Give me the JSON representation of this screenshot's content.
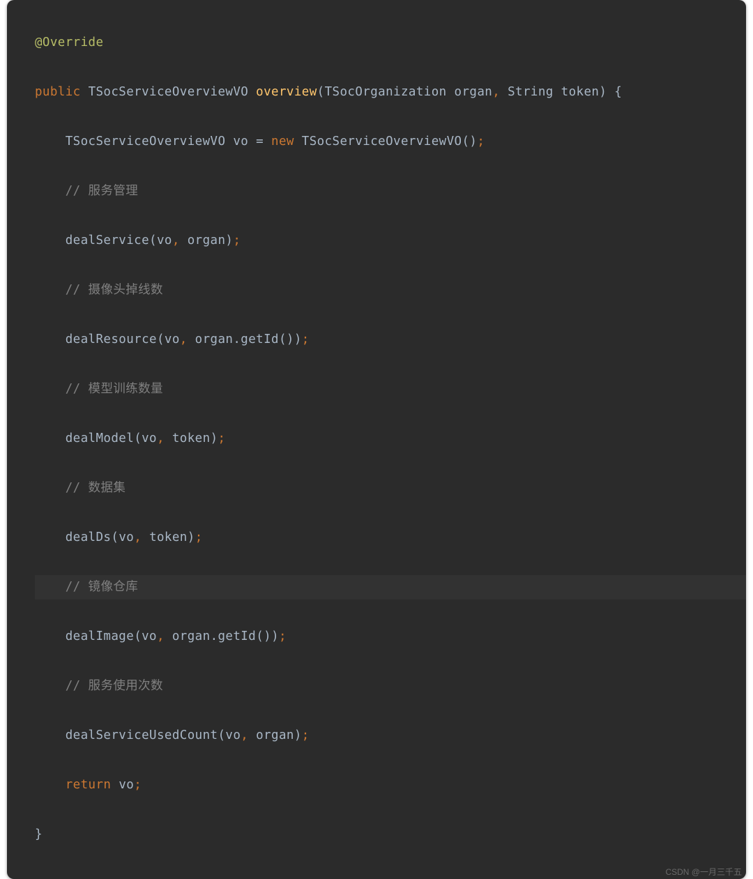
{
  "code": {
    "line1": {
      "anno": "@Override"
    },
    "line2": {
      "kw_public": "public",
      "ret_type": "TSocServiceOverviewVO",
      "method": "overview",
      "p1_type": "TSocOrganization",
      "p1_name": "organ",
      "p2_type": "String",
      "p2_name": "token",
      "open_brace": "{"
    },
    "line3": {
      "type": "TSocServiceOverviewVO",
      "var": "vo",
      "eq": "=",
      "kw_new": "new",
      "ctor": "TSocServiceOverviewVO",
      "parens": "()",
      "semi": ";"
    },
    "line4": {
      "comment": "// 服务管理"
    },
    "line5": {
      "call": "dealService",
      "args_open": "(",
      "a1": "vo",
      "c": ", ",
      "a2": "organ",
      "args_close": ")",
      "semi": ";"
    },
    "line6": {
      "comment": "// 摄像头掉线数"
    },
    "line7": {
      "call": "dealResource",
      "args_open": "(",
      "a1": "vo",
      "c": ", ",
      "a2": "organ",
      "dot": ".",
      "sub": "getId",
      "subp": "()",
      "args_close": ")",
      "semi": ";"
    },
    "line8": {
      "comment": "// 模型训练数量"
    },
    "line9": {
      "call": "dealModel",
      "args_open": "(",
      "a1": "vo",
      "c": ", ",
      "a2": "token",
      "args_close": ")",
      "semi": ";"
    },
    "line10": {
      "comment": "// 数据集"
    },
    "line11": {
      "call": "dealDs",
      "args_open": "(",
      "a1": "vo",
      "c": ", ",
      "a2": "token",
      "args_close": ")",
      "semi": ";"
    },
    "line12": {
      "comment": "// 镜像仓库"
    },
    "line13": {
      "call": "dealImage",
      "args_open": "(",
      "a1": "vo",
      "c": ", ",
      "a2": "organ",
      "dot": ".",
      "sub": "getId",
      "subp": "()",
      "args_close": ")",
      "semi": ";"
    },
    "line14": {
      "comment": "// 服务使用次数"
    },
    "line15": {
      "call": "dealServiceUsedCount",
      "args_open": "(",
      "a1": "vo",
      "c": ", ",
      "a2": "organ",
      "args_close": ")",
      "semi": ";"
    },
    "line16": {
      "kw_return": "return",
      "var": "vo",
      "semi": ";"
    },
    "line17": {
      "close_brace": "}"
    }
  },
  "watermark": "CSDN @一月三千五"
}
